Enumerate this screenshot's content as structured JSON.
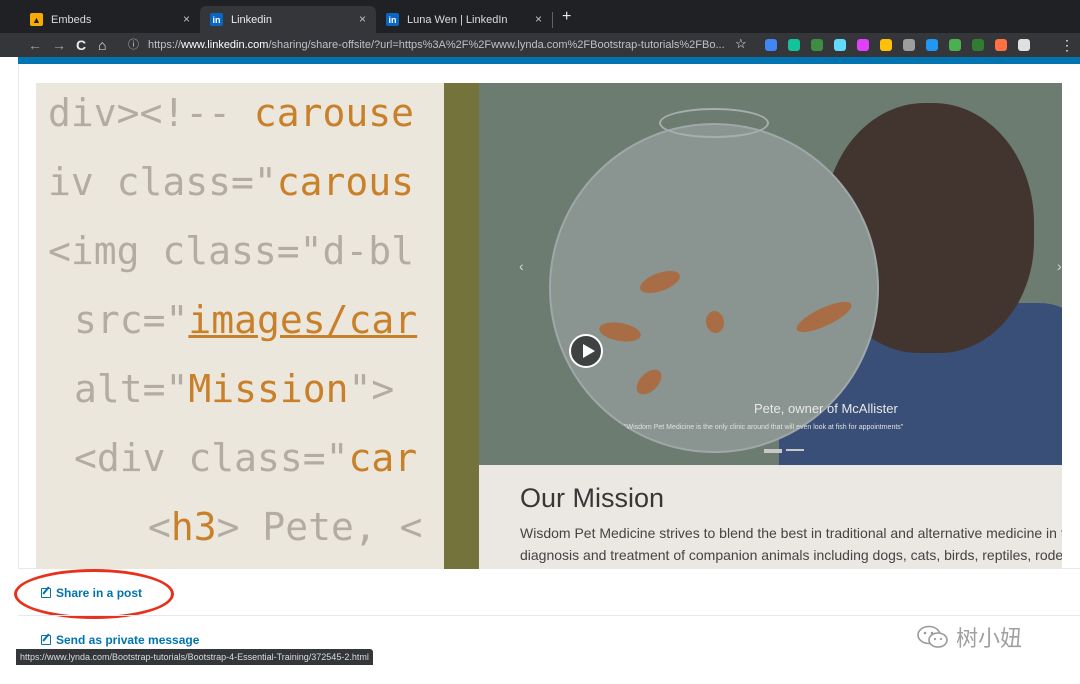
{
  "browser": {
    "tabs": [
      {
        "title": "Embeds",
        "icon": "embeds-favicon"
      },
      {
        "title": "Linkedin",
        "icon": "linkedin-favicon"
      },
      {
        "title": "Luna Wen | LinkedIn",
        "icon": "linkedin-favicon"
      }
    ],
    "active_tab": 1,
    "new_tab_label": "+",
    "close_label": "×",
    "url_scheme": "https://",
    "url_host": "www.linkedin.com",
    "url_rest": "/sharing/share-offsite/?url=https%3A%2F%2Fwww.lynda.com%2FBootstrap-tutorials%2FBo...",
    "nav": {
      "back": "←",
      "forward": "→",
      "reload": "C",
      "home": "⌂"
    },
    "star": "☆",
    "extension_colors": [
      "#4285f4",
      "#15c39a",
      "#3e8e41",
      "#61dafb",
      "#e040fb",
      "#ffc107",
      "#9e9e9e",
      "#2196f3",
      "#4caf50",
      "#2e7d32",
      "#ff7043",
      "#e0e0e0"
    ]
  },
  "preview": {
    "code_lines": [
      {
        "plain1": "div><!-- ",
        "hl": "carouse",
        "plain2": ""
      },
      {
        "plain1": "iv class=\"",
        "hl": "carous",
        "plain2": ""
      },
      {
        "plain1": "<img class=\"d-bl",
        "hl": "",
        "plain2": ""
      },
      {
        "plain1": "src=\"",
        "hl": "images/car",
        "plain2": ""
      },
      {
        "plain1": "alt=\"",
        "hl": "Mission",
        "plain2": "\">"
      },
      {
        "plain1": "<div class=\"",
        "hl": "car",
        "plain2": ""
      },
      {
        "plain1": "<",
        "hl": "h3",
        "plain2": "> Pete, <"
      }
    ],
    "caption_name": "Pete, owner of McAllister",
    "caption_quote": "\"Wisdom Pet Medicine is the only clinic around that will even look at fish for appointments\"",
    "mission_title": "Our Mission",
    "mission_text": "Wisdom Pet Medicine strives to blend the best in traditional and alternative medicine in the diagnosis and treatment of companion animals including dogs, cats, birds, reptiles, rodents,"
  },
  "actions": {
    "share_post": "Share in a post",
    "send_message": "Send as private message"
  },
  "status_url": "https://www.lynda.com/Bootstrap-tutorials/Bootstrap-4-Essential-Training/372545-2.html",
  "watermark": "树小妞",
  "colors": {
    "linkedin_blue": "#0073b1",
    "annotation_red": "#e8311c"
  }
}
